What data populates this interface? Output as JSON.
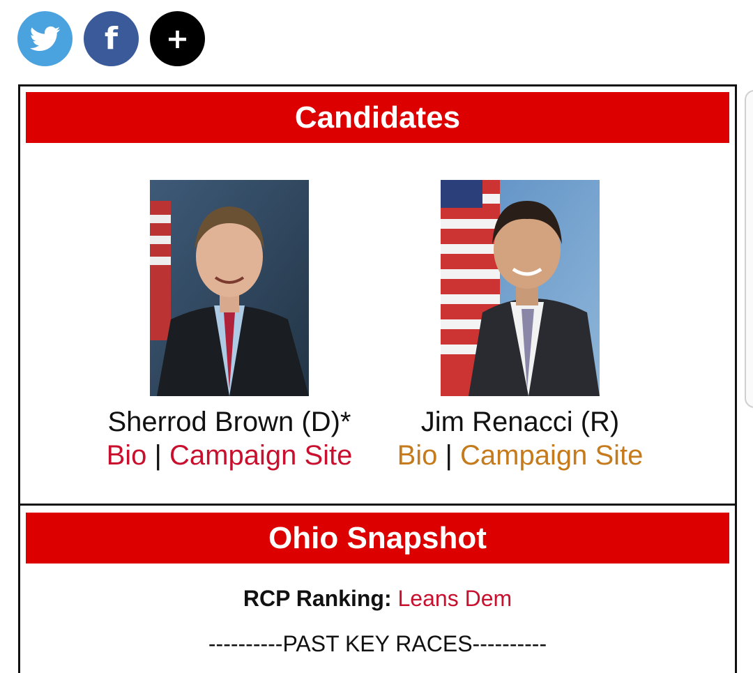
{
  "share": {
    "twitter_icon": "twitter-bird-icon",
    "facebook_icon": "facebook-f-icon",
    "facebook_glyph": "f",
    "more_icon": "plus-icon",
    "more_glyph": "+",
    "colors": {
      "twitter": "#4aa3df",
      "facebook": "#3b5a9a",
      "more": "#000000"
    }
  },
  "candidates": {
    "header": "Candidates",
    "list": [
      {
        "name": "Sherrod Brown (D)*",
        "bio_label": "Bio",
        "separator": "|",
        "campaign_label": "Campaign Site",
        "link_color": "#c8102e"
      },
      {
        "name": "Jim Renacci (R)",
        "bio_label": "Bio",
        "separator": "|",
        "campaign_label": "Campaign Site",
        "link_color": "#c57a1b"
      }
    ]
  },
  "snapshot": {
    "header": "Ohio Snapshot",
    "ranking_label": "RCP Ranking:",
    "ranking_value": "Leans Dem",
    "past_key_races": "----------PAST KEY RACES----------"
  },
  "colors": {
    "header_bg": "#dd0000",
    "header_text": "#ffffff"
  }
}
